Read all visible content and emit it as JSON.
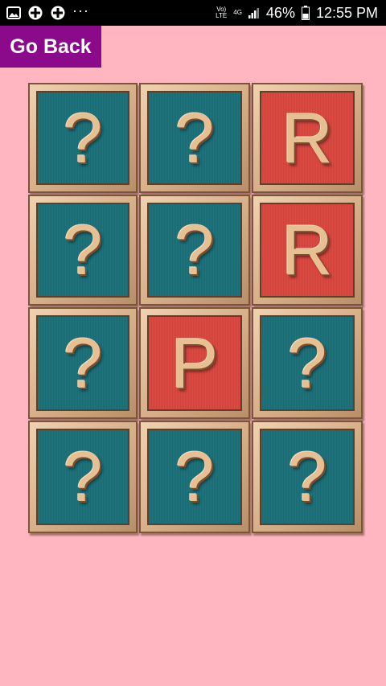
{
  "status_bar": {
    "icons": [
      "image-icon",
      "game-controller-icon",
      "game-controller-icon",
      "more-dots-icon"
    ],
    "dots": "···",
    "volte": "Vo)\nLTE",
    "network": "4G",
    "battery_percent": "46%",
    "time": "12:55 PM"
  },
  "go_back_label": "Go Back",
  "colors": {
    "background": "#ffb6c1",
    "button": "#8b0a8b",
    "hidden_tile": "#1a6e78",
    "revealed_tile": "#d9453d",
    "frame": "#d8b08a"
  },
  "board": {
    "rows": 4,
    "cols": 3,
    "tiles": [
      {
        "symbol": "?",
        "state": "hidden"
      },
      {
        "symbol": "?",
        "state": "hidden"
      },
      {
        "symbol": "R",
        "state": "revealed"
      },
      {
        "symbol": "?",
        "state": "hidden"
      },
      {
        "symbol": "?",
        "state": "hidden"
      },
      {
        "symbol": "R",
        "state": "revealed"
      },
      {
        "symbol": "?",
        "state": "hidden"
      },
      {
        "symbol": "P",
        "state": "revealed"
      },
      {
        "symbol": "?",
        "state": "hidden"
      },
      {
        "symbol": "?",
        "state": "hidden"
      },
      {
        "symbol": "?",
        "state": "hidden"
      },
      {
        "symbol": "?",
        "state": "hidden"
      }
    ]
  }
}
